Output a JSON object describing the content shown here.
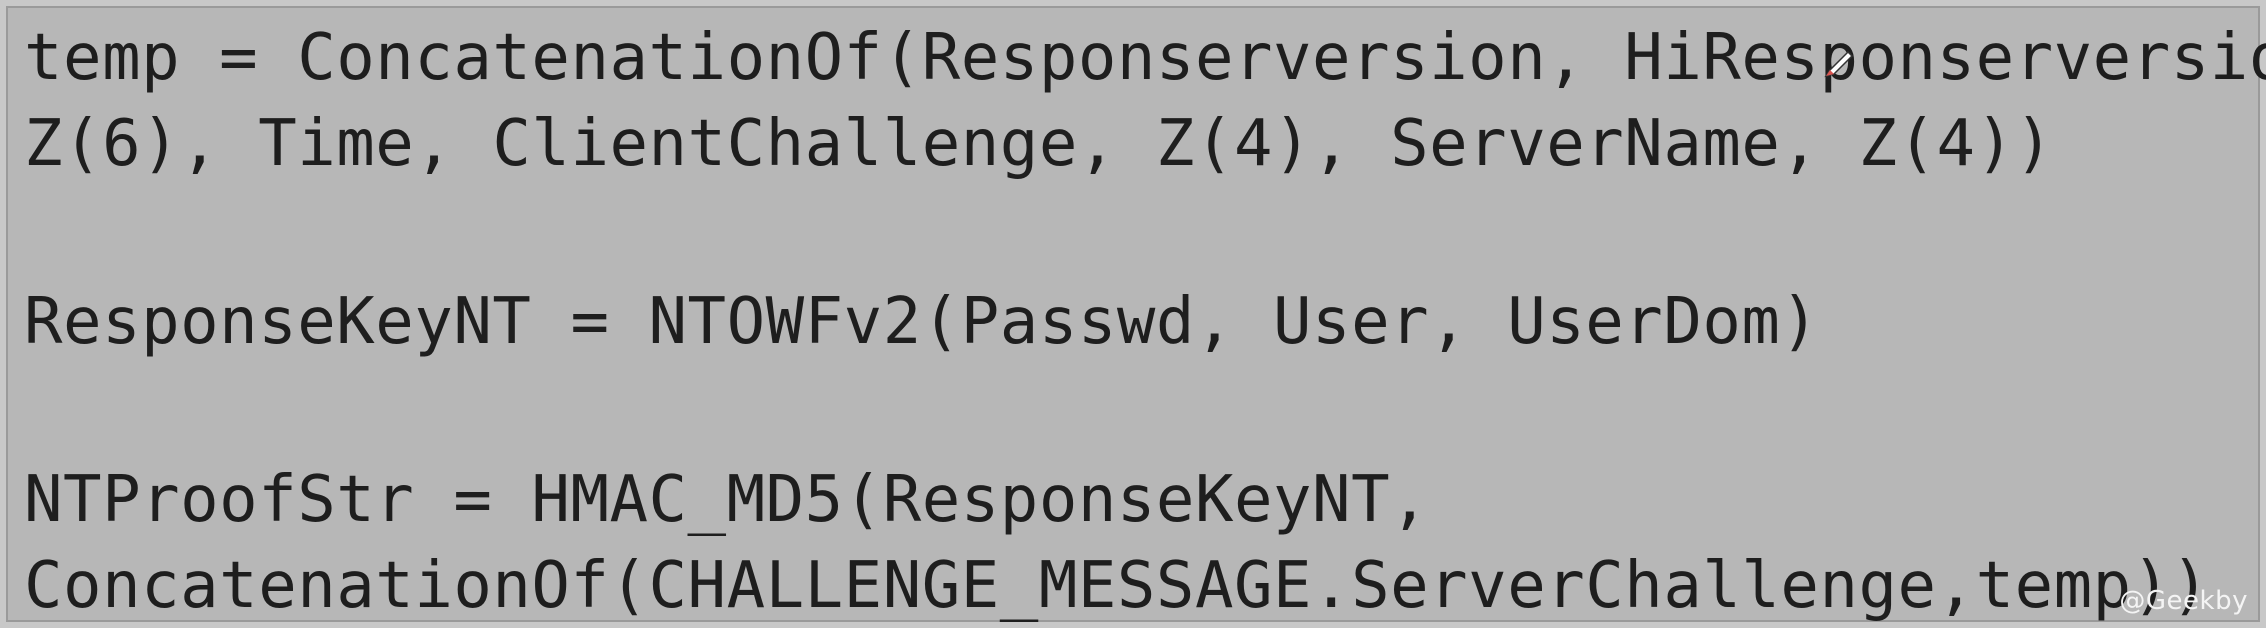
{
  "code": {
    "lines": [
      "temp = ConcatenationOf(Responserversion, HiResponserversion,",
      "Z(6), Time, ClientChallenge, Z(4), ServerName, Z(4))",
      "ResponseKeyNT = NTOWFv2(Passwd, User, UserDom)",
      "NTProofStr = HMAC_MD5(ResponseKeyNT,",
      "ConcatenationOf(CHALLENGE_MESSAGE.ServerChallenge,temp))"
    ]
  },
  "watermark": "@Geekby",
  "icons": {
    "cursor": "pen-cursor-icon"
  }
}
